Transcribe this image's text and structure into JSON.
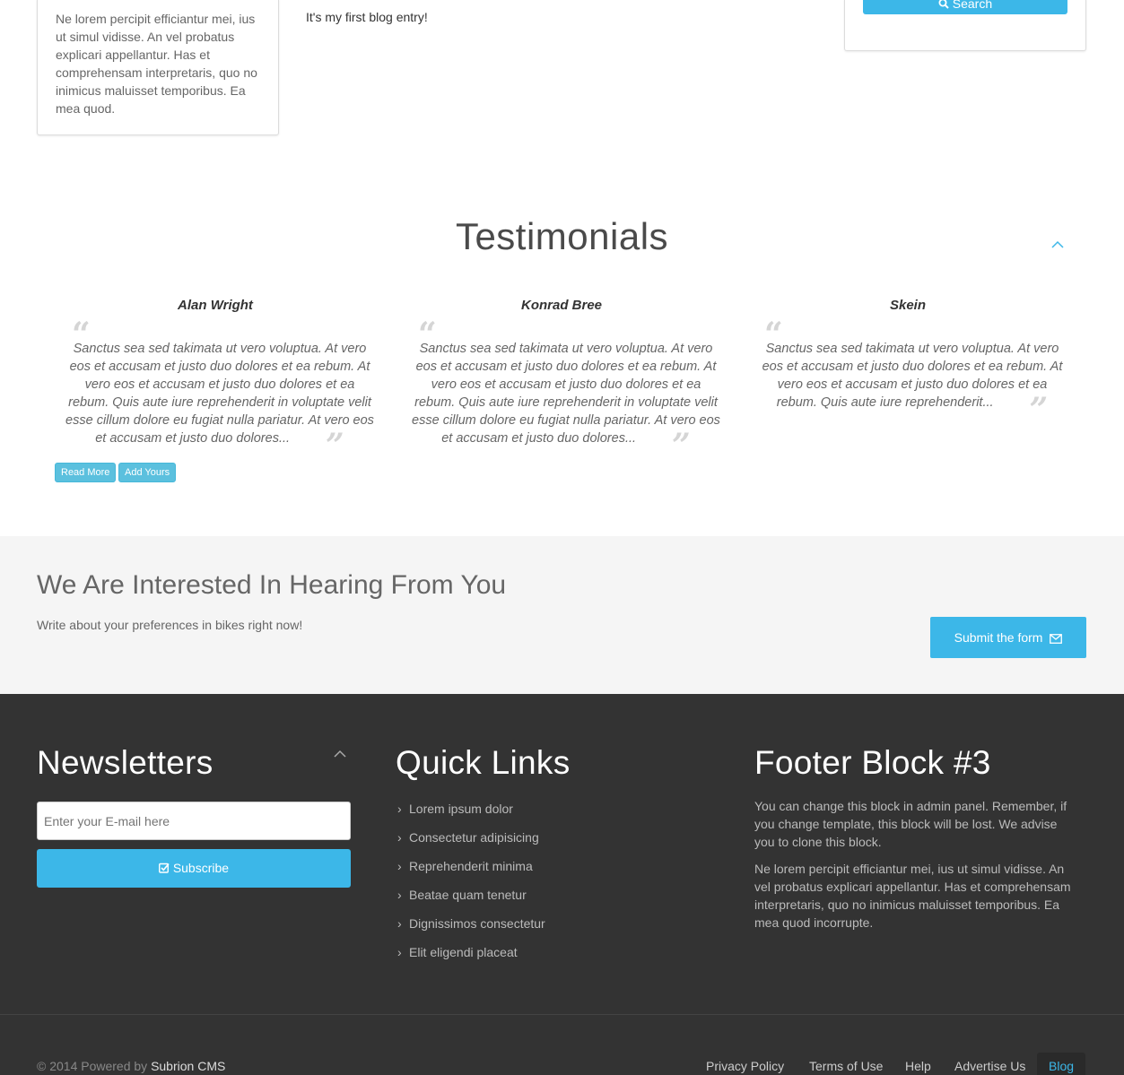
{
  "top": {
    "left_box_text": "Ne lorem percipit efficiantur mei, ius ut simul vidisse. An vel probatus explicari appellantur. Has et comprehensam interpretaris, quo no inimicus maluisset temporibus. Ea mea quod.",
    "blog_entry": "It's my first blog entry!",
    "search_label": "Search"
  },
  "testimonials": {
    "title": "Testimonials",
    "items": [
      {
        "name": "Alan Wright",
        "text": "Sanctus sea sed takimata ut vero voluptua. At vero eos et accusam et justo duo dolores et ea rebum. At vero eos et accusam et justo duo dolores et ea rebum. Quis aute iure reprehenderit in voluptate velit esse cillum dolore eu fugiat nulla pariatur. At vero eos et accusam et justo duo dolores..."
      },
      {
        "name": "Konrad Bree",
        "text": "Sanctus sea sed takimata ut vero voluptua. At vero eos et accusam et justo duo dolores et ea rebum. At vero eos et accusam et justo duo dolores et ea rebum. Quis aute iure reprehenderit in voluptate velit esse cillum dolore eu fugiat nulla pariatur. At vero eos et accusam et justo duo dolores..."
      },
      {
        "name": "Skein",
        "text": "Sanctus sea sed takimata ut vero voluptua. At vero eos et accusam et justo duo dolores et ea rebum. At vero eos et accusam et justo duo dolores et ea rebum. Quis aute iure reprehenderit..."
      }
    ],
    "read_more": "Read More",
    "add_yours": "Add Yours"
  },
  "interested": {
    "title": "We Are Interested In Hearing From You",
    "subtitle": "Write about your preferences in bikes right now!",
    "button": "Submit the form"
  },
  "footer": {
    "newsletters": {
      "title": "Newsletters",
      "placeholder": "Enter your E-mail here",
      "button": "Subscribe"
    },
    "quick_links": {
      "title": "Quick Links",
      "items": [
        "Lorem ipsum dolor",
        "Consectetur adipisicing",
        "Reprehenderit minima",
        "Beatae quam tenetur",
        "Dignissimos consectetur",
        "Elit eligendi placeat"
      ]
    },
    "block3": {
      "title": "Footer Block #3",
      "p1": "You can change this block in admin panel. Remember, if you change template, this block will be lost. We advise you to clone this block.",
      "p2": "Ne lorem percipit efficiantur mei, ius ut simul vidisse. An vel probatus explicari appellantur. Has et comprehensam interpretaris, quo no inimicus maluisset temporibus. Ea mea quod incorrupte."
    },
    "copyright_prefix": "© 2014 Powered by",
    "copyright_link": "Subrion CMS",
    "nav": [
      "Privacy Policy",
      "Terms of Use",
      "Help",
      "Advertise Us",
      "Blog"
    ]
  },
  "colors": {
    "accent": "#3cb7e8",
    "footer_bg": "#333333",
    "band_bg": "#f5f5f5"
  }
}
